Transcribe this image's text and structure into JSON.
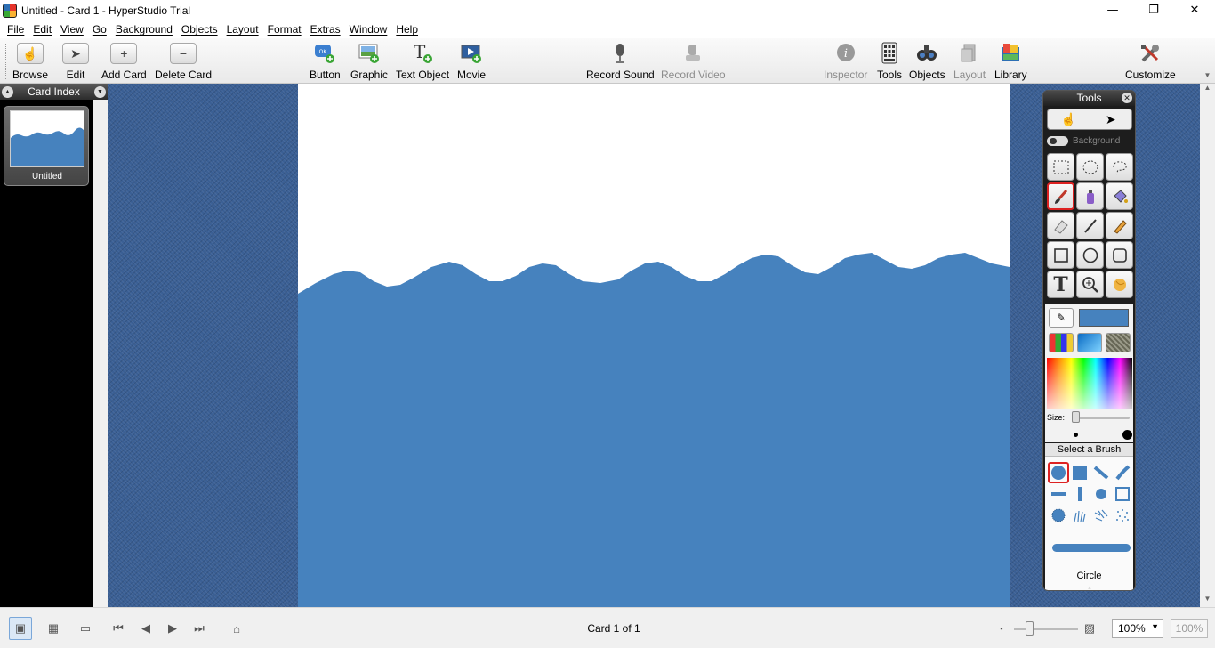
{
  "window": {
    "title": "Untitled - Card 1 - HyperStudio Trial",
    "minimize_glyph": "—",
    "restore_glyph": "❐",
    "close_glyph": "✕"
  },
  "menu": [
    "File",
    "Edit",
    "View",
    "Go",
    "Background",
    "Objects",
    "Layout",
    "Format",
    "Extras",
    "Window",
    "Help"
  ],
  "toolbar": {
    "browse": "Browse",
    "edit": "Edit",
    "add_card": "Add Card",
    "delete_card": "Delete Card",
    "button": "Button",
    "graphic": "Graphic",
    "text_object": "Text Object",
    "movie": "Movie",
    "record_sound": "Record Sound",
    "record_video": "Record Video",
    "inspector": "Inspector",
    "tools": "Tools",
    "objects": "Objects",
    "layout": "Layout",
    "library": "Library",
    "customize": "Customize"
  },
  "card_index": {
    "title": "Card Index",
    "cards": [
      {
        "label": "Untitled"
      }
    ]
  },
  "tools_palette": {
    "title": "Tools",
    "background_label": "Background",
    "size_label": "Size:",
    "brush_header": "Select a Brush",
    "brush_name": "Circle",
    "current_color": "#4682be",
    "size_level": 0.05,
    "tools": [
      "rect-select",
      "oval-select",
      "lasso",
      "brush",
      "spray",
      "fill-bucket",
      "eraser",
      "line",
      "pencil",
      "rectangle",
      "oval",
      "rounded-rect",
      "text",
      "zoom",
      "smudge"
    ],
    "selected_tool": "brush"
  },
  "card": {
    "background_color": "#ffffff",
    "fill_color": "#4682be"
  },
  "status": {
    "card_count": "Card 1 of 1",
    "zoom_value": "100%",
    "zoom_fixed": "100%"
  }
}
